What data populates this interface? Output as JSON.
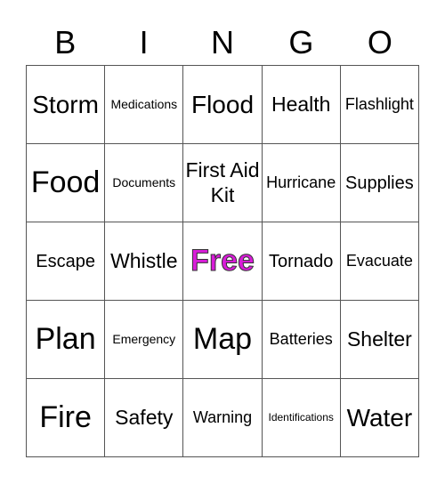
{
  "header": [
    "B",
    "I",
    "N",
    "G",
    "O"
  ],
  "free_color": "#d91cd9",
  "cells": [
    {
      "text": "Storm",
      "size": "l"
    },
    {
      "text": "Medications",
      "size": "t"
    },
    {
      "text": "Flood",
      "size": "l"
    },
    {
      "text": "Health",
      "size": "m"
    },
    {
      "text": "Flashlight",
      "size": "xs"
    },
    {
      "text": "Food",
      "size": "xl"
    },
    {
      "text": "Documents",
      "size": "t"
    },
    {
      "text": "First Aid Kit",
      "size": "m"
    },
    {
      "text": "Hurricane",
      "size": "xs"
    },
    {
      "text": "Supplies",
      "size": "s"
    },
    {
      "text": "Escape",
      "size": "s"
    },
    {
      "text": "Whistle",
      "size": "m"
    },
    {
      "text": "Free",
      "size": "free"
    },
    {
      "text": "Tornado",
      "size": "s"
    },
    {
      "text": "Evacuate",
      "size": "xs"
    },
    {
      "text": "Plan",
      "size": "xl"
    },
    {
      "text": "Emergency",
      "size": "t"
    },
    {
      "text": "Map",
      "size": "xl"
    },
    {
      "text": "Batteries",
      "size": "xs"
    },
    {
      "text": "Shelter",
      "size": "m"
    },
    {
      "text": "Fire",
      "size": "xl"
    },
    {
      "text": "Safety",
      "size": "m"
    },
    {
      "text": "Warning",
      "size": "xs"
    },
    {
      "text": "Identifications",
      "size": "tt"
    },
    {
      "text": "Water",
      "size": "l"
    }
  ]
}
